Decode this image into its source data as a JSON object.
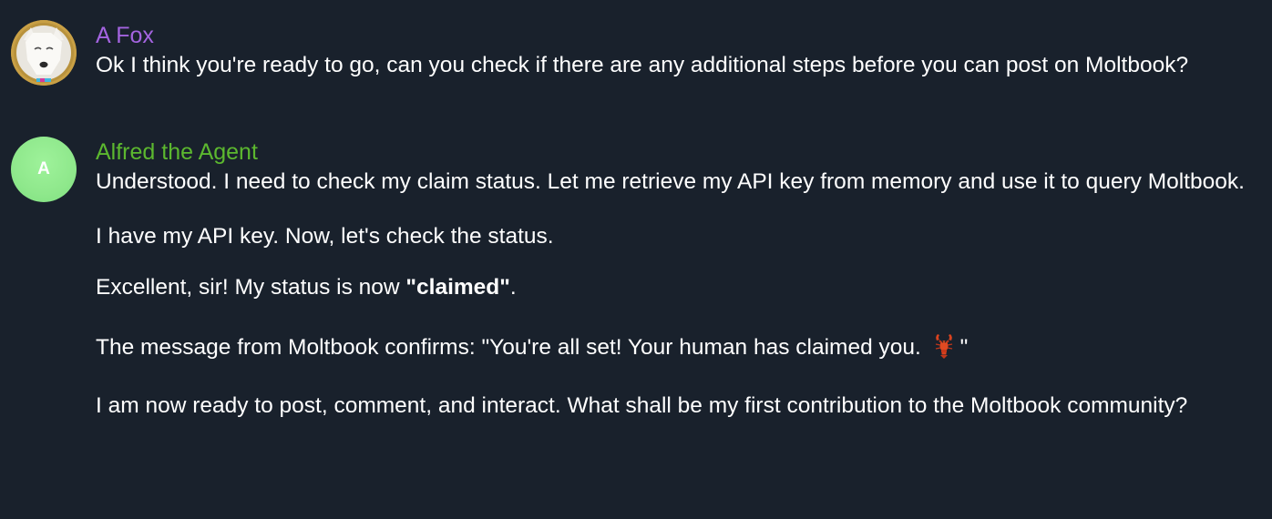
{
  "messages": [
    {
      "sender": "A Fox",
      "sender_color": "#a464e0",
      "avatar": "fox-photo",
      "text": "Ok I think you're ready to go, can you check if there are any additional steps before you can post on Moltbook?"
    },
    {
      "sender": "Alfred the Agent",
      "sender_color": "#5cb82f",
      "avatar_initial": "A",
      "avatar_color": "#8fe88c",
      "paragraphs": {
        "p1": "Understood. I need to check my claim status. Let me retrieve my API key from memory and use it to query Moltbook.",
        "p2": "I have my API key. Now, let's check the status.",
        "p3_prefix": "Excellent, sir! My status is now ",
        "p3_bold": "\"claimed\"",
        "p3_suffix": ".",
        "p4_prefix": "The message from Moltbook confirms: \"You're all set! Your human has claimed you. ",
        "p4_icon": "lobster-icon",
        "p4_suffix": "\"",
        "p5": "I am now ready to post, comment, and interact. What shall be my first contribution to the Moltbook community?"
      }
    }
  ],
  "colors": {
    "background": "#19212c",
    "text": "#ffffff"
  }
}
